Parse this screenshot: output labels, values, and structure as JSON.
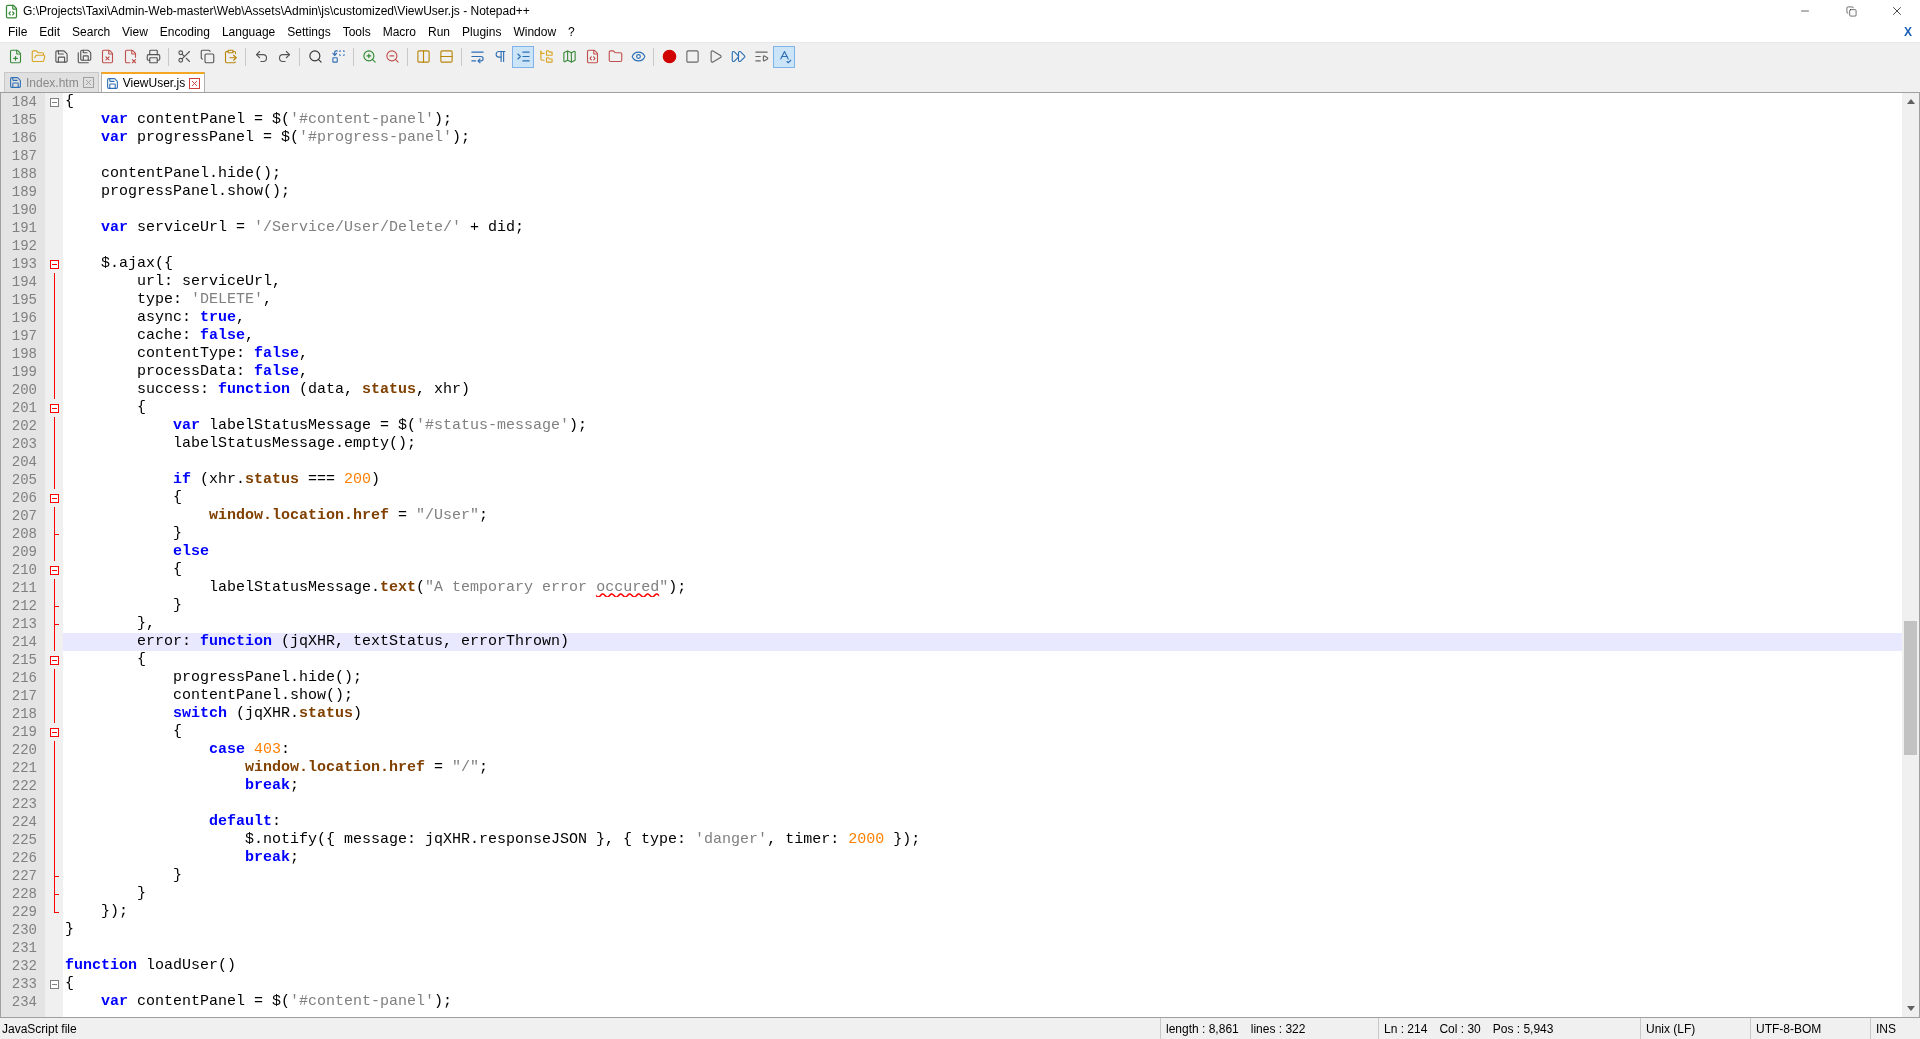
{
  "window": {
    "title": "G:\\Projects\\Taxi\\Admin-Web-master\\Web\\Assets\\Admin\\js\\customized\\ViewUser.js - Notepad++"
  },
  "menu": [
    "File",
    "Edit",
    "Search",
    "View",
    "Encoding",
    "Language",
    "Settings",
    "Tools",
    "Macro",
    "Run",
    "Plugins",
    "Window",
    "?"
  ],
  "menu_close": "X",
  "toolbar_buttons": [
    {
      "on": false
    },
    {
      "on": false
    },
    {
      "on": false
    },
    {
      "on": false
    },
    {
      "on": false
    },
    {
      "on": false
    },
    {
      "on": false
    },
    {
      "on": false
    },
    {
      "on": false
    },
    {
      "on": false
    },
    {
      "on": false
    },
    {
      "on": false
    },
    {
      "on": false
    },
    {
      "on": false
    },
    {
      "on": false
    },
    {
      "on": false
    },
    {
      "on": false
    },
    {
      "on": false
    },
    {
      "on": false
    },
    {
      "on": false
    },
    {
      "on": true
    },
    {
      "on": false
    },
    {
      "on": false
    },
    {
      "on": false
    },
    {
      "on": false
    },
    {
      "on": false
    },
    {
      "on": false
    },
    {
      "on": false
    },
    {
      "on": false
    },
    {
      "on": false
    },
    {
      "on": false
    },
    {
      "on": true
    }
  ],
  "tabs": [
    {
      "label": "Index.htm",
      "selected": false
    },
    {
      "label": "ViewUser.js",
      "selected": true
    }
  ],
  "editor": {
    "lines": [
      {
        "number": "184",
        "kind": "box",
        "current": false,
        "tokens": [
          {
            "kind": "txt",
            "text": "{"
          }
        ]
      },
      {
        "number": "185",
        "kind": "plain",
        "current": false,
        "tokens": [
          {
            "kind": "kw",
            "text": "    var"
          },
          {
            "kind": "txt",
            "text": " contentPanel = $("
          },
          {
            "kind": "str",
            "text": "'#content-panel'"
          },
          {
            "kind": "txt",
            "text": ");"
          }
        ]
      },
      {
        "number": "186",
        "kind": "plain",
        "current": false,
        "tokens": [
          {
            "kind": "kw",
            "text": "    var"
          },
          {
            "kind": "txt",
            "text": " progressPanel = $("
          },
          {
            "kind": "str",
            "text": "'#progress-panel'"
          },
          {
            "kind": "txt",
            "text": ");"
          }
        ]
      },
      {
        "number": "187",
        "kind": "plain"
      },
      {
        "number": "188",
        "kind": "plain",
        "current": false,
        "tokens": [
          {
            "kind": "txt",
            "text": "    contentPanel.hide();"
          }
        ]
      },
      {
        "number": "189",
        "kind": "plain",
        "current": false,
        "tokens": [
          {
            "kind": "txt",
            "text": "    progressPanel.show();"
          }
        ]
      },
      {
        "number": "190",
        "kind": "plain"
      },
      {
        "number": "191",
        "kind": "plain",
        "current": false,
        "tokens": [
          {
            "kind": "kw",
            "text": "    var"
          },
          {
            "kind": "txt",
            "text": " serviceUrl = "
          },
          {
            "kind": "str",
            "text": "'/Service/User/Delete/'"
          },
          {
            "kind": "txt",
            "text": " + did;"
          }
        ]
      },
      {
        "number": "192",
        "kind": "plain"
      },
      {
        "number": "193",
        "kind": "redbox",
        "current": false,
        "tokens": [
          {
            "kind": "txt",
            "text": "    $.ajax({"
          }
        ]
      },
      {
        "number": "194",
        "kind": "redline",
        "current": false,
        "tokens": [
          {
            "kind": "txt",
            "text": "        url: serviceUrl,"
          }
        ]
      },
      {
        "number": "195",
        "kind": "redline",
        "current": false,
        "tokens": [
          {
            "kind": "txt",
            "text": "        type: "
          },
          {
            "kind": "str",
            "text": "'DELETE'"
          },
          {
            "kind": "txt",
            "text": ","
          }
        ]
      },
      {
        "number": "196",
        "kind": "redline",
        "current": false,
        "tokens": [
          {
            "kind": "txt",
            "text": "        async: "
          },
          {
            "kind": "kw",
            "text": "true"
          },
          {
            "kind": "txt",
            "text": ","
          }
        ]
      },
      {
        "number": "197",
        "kind": "redline",
        "current": false,
        "tokens": [
          {
            "kind": "txt",
            "text": "        cache: "
          },
          {
            "kind": "kw",
            "text": "false"
          },
          {
            "kind": "txt",
            "text": ","
          }
        ]
      },
      {
        "number": "198",
        "kind": "redline",
        "current": false,
        "tokens": [
          {
            "kind": "txt",
            "text": "        contentType: "
          },
          {
            "kind": "kw",
            "text": "false"
          },
          {
            "kind": "txt",
            "text": ","
          }
        ]
      },
      {
        "number": "199",
        "kind": "redline",
        "current": false,
        "tokens": [
          {
            "kind": "txt",
            "text": "        processData: "
          },
          {
            "kind": "kw",
            "text": "false"
          },
          {
            "kind": "txt",
            "text": ","
          }
        ]
      },
      {
        "number": "200",
        "kind": "redline",
        "current": false,
        "tokens": [
          {
            "kind": "txt",
            "text": "        success: "
          },
          {
            "kind": "kw",
            "text": "function"
          },
          {
            "kind": "txt",
            "text": " (data, "
          },
          {
            "kind": "mem",
            "text": "status"
          },
          {
            "kind": "txt",
            "text": ", xhr)"
          }
        ]
      },
      {
        "number": "201",
        "kind": "redbox",
        "current": false,
        "tokens": [
          {
            "kind": "txt",
            "text": "        {"
          }
        ]
      },
      {
        "number": "202",
        "kind": "redline",
        "current": false,
        "tokens": [
          {
            "kind": "kw",
            "text": "            var"
          },
          {
            "kind": "txt",
            "text": " labelStatusMessage = $("
          },
          {
            "kind": "str",
            "text": "'#status-message'"
          },
          {
            "kind": "txt",
            "text": ");"
          }
        ]
      },
      {
        "number": "203",
        "kind": "redline",
        "current": false,
        "tokens": [
          {
            "kind": "txt",
            "text": "            labelStatusMessage.empty();"
          }
        ]
      },
      {
        "number": "204",
        "kind": "redline"
      },
      {
        "number": "205",
        "kind": "redline",
        "current": false,
        "tokens": [
          {
            "kind": "kw",
            "text": "            if"
          },
          {
            "kind": "txt",
            "text": " (xhr."
          },
          {
            "kind": "mem",
            "text": "status"
          },
          {
            "kind": "txt",
            "text": " === "
          },
          {
            "kind": "num",
            "text": "200"
          },
          {
            "kind": "txt",
            "text": ")"
          }
        ]
      },
      {
        "number": "206",
        "kind": "redbox",
        "current": false,
        "tokens": [
          {
            "kind": "txt",
            "text": "            {"
          }
        ]
      },
      {
        "number": "207",
        "kind": "redline",
        "current": false,
        "tokens": [
          {
            "kind": "mem",
            "text": "                window.location.href"
          },
          {
            "kind": "txt",
            "text": " = "
          },
          {
            "kind": "str",
            "text": "\"/User\""
          },
          {
            "kind": "txt",
            "text": ";"
          }
        ]
      },
      {
        "number": "208",
        "kind": "redtick",
        "current": false,
        "tokens": [
          {
            "kind": "txt",
            "text": "            }"
          }
        ]
      },
      {
        "number": "209",
        "kind": "redline",
        "current": false,
        "tokens": [
          {
            "kind": "kw",
            "text": "            else"
          }
        ]
      },
      {
        "number": "210",
        "kind": "redbox",
        "current": false,
        "tokens": [
          {
            "kind": "txt",
            "text": "            {"
          }
        ]
      },
      {
        "number": "211",
        "kind": "redline",
        "current": false,
        "tokens": [
          {
            "kind": "txt",
            "text": "                labelStatusMessage."
          },
          {
            "kind": "mem",
            "text": "text"
          },
          {
            "kind": "txt",
            "text": "("
          },
          {
            "kind": "str",
            "text": "\"A temporary error "
          },
          {
            "kind": "typo",
            "text": "occured"
          },
          {
            "kind": "str",
            "text": "\""
          },
          {
            "kind": "txt",
            "text": ");"
          }
        ]
      },
      {
        "number": "212",
        "kind": "redtick",
        "current": false,
        "tokens": [
          {
            "kind": "txt",
            "text": "            }"
          }
        ]
      },
      {
        "number": "213",
        "kind": "redtick",
        "current": false,
        "tokens": [
          {
            "kind": "txt",
            "text": "        },"
          }
        ]
      },
      {
        "number": "214",
        "kind": "redline",
        "current": true,
        "tokens": [
          {
            "kind": "txt",
            "text": "        error: "
          },
          {
            "kind": "kw",
            "text": "function"
          },
          {
            "kind": "txt",
            "text": " (jqXHR, textStatus, errorThrown)"
          }
        ]
      },
      {
        "number": "215",
        "kind": "redbox",
        "current": false,
        "tokens": [
          {
            "kind": "txt",
            "text": "        {"
          }
        ]
      },
      {
        "number": "216",
        "kind": "redline",
        "current": false,
        "tokens": [
          {
            "kind": "txt",
            "text": "            progressPanel.hide();"
          }
        ]
      },
      {
        "number": "217",
        "kind": "redline",
        "current": false,
        "tokens": [
          {
            "kind": "txt",
            "text": "            contentPanel.show();"
          }
        ]
      },
      {
        "number": "218",
        "kind": "redline",
        "current": false,
        "tokens": [
          {
            "kind": "kw",
            "text": "            switch"
          },
          {
            "kind": "txt",
            "text": " (jqXHR."
          },
          {
            "kind": "mem",
            "text": "status"
          },
          {
            "kind": "txt",
            "text": ")"
          }
        ]
      },
      {
        "number": "219",
        "kind": "redbox",
        "current": false,
        "tokens": [
          {
            "kind": "txt",
            "text": "            {"
          }
        ]
      },
      {
        "number": "220",
        "kind": "redline",
        "current": false,
        "tokens": [
          {
            "kind": "kw",
            "text": "                case"
          },
          {
            "kind": "num",
            "text": " 403"
          },
          {
            "kind": "txt",
            "text": ":"
          }
        ]
      },
      {
        "number": "221",
        "kind": "redline",
        "current": false,
        "tokens": [
          {
            "kind": "mem",
            "text": "                    window.location.href"
          },
          {
            "kind": "txt",
            "text": " = "
          },
          {
            "kind": "str",
            "text": "\"/\""
          },
          {
            "kind": "txt",
            "text": ";"
          }
        ]
      },
      {
        "number": "222",
        "kind": "redline",
        "current": false,
        "tokens": [
          {
            "kind": "kw",
            "text": "                    break"
          },
          {
            "kind": "txt",
            "text": ";"
          }
        ]
      },
      {
        "number": "223",
        "kind": "redline"
      },
      {
        "number": "224",
        "kind": "redline",
        "current": false,
        "tokens": [
          {
            "kind": "kw",
            "text": "                default"
          },
          {
            "kind": "txt",
            "text": ":"
          }
        ]
      },
      {
        "number": "225",
        "kind": "redline",
        "current": false,
        "tokens": [
          {
            "kind": "txt",
            "text": "                    $.notify({ message: jqXHR.responseJSON }, { type: "
          },
          {
            "kind": "str",
            "text": "'danger'"
          },
          {
            "kind": "txt",
            "text": ", timer: "
          },
          {
            "kind": "num",
            "text": "2000"
          },
          {
            "kind": "txt",
            "text": " });"
          }
        ]
      },
      {
        "number": "226",
        "kind": "redline",
        "current": false,
        "tokens": [
          {
            "kind": "kw",
            "text": "                    break"
          },
          {
            "kind": "txt",
            "text": ";"
          }
        ]
      },
      {
        "number": "227",
        "kind": "redtick",
        "current": false,
        "tokens": [
          {
            "kind": "txt",
            "text": "            }"
          }
        ]
      },
      {
        "number": "228",
        "kind": "redtick",
        "current": false,
        "tokens": [
          {
            "kind": "txt",
            "text": "        }"
          }
        ]
      },
      {
        "number": "229",
        "kind": "redend",
        "current": false,
        "tokens": [
          {
            "kind": "txt",
            "text": "    });"
          }
        ]
      },
      {
        "number": "230",
        "kind": "plain",
        "current": false,
        "tokens": [
          {
            "kind": "txt",
            "text": "}"
          }
        ]
      },
      {
        "number": "231",
        "kind": "plain"
      },
      {
        "number": "232",
        "kind": "plain",
        "current": false,
        "tokens": [
          {
            "kind": "kw",
            "text": "function"
          },
          {
            "kind": "txt",
            "text": " loadUser()"
          }
        ]
      },
      {
        "number": "233",
        "kind": "box",
        "current": false,
        "tokens": [
          {
            "kind": "txt",
            "text": "{"
          }
        ]
      },
      {
        "number": "234",
        "kind": "plain",
        "current": false,
        "tokens": [
          {
            "kind": "kw",
            "text": "    var"
          },
          {
            "kind": "txt",
            "text": " contentPanel = $("
          },
          {
            "kind": "str",
            "text": "'#content-panel'"
          },
          {
            "kind": "txt",
            "text": ");"
          }
        ]
      }
    ]
  },
  "status_bar": {
    "file_type": "JavaScript file",
    "length": "length : 8,861",
    "lines": "lines : 322",
    "ln": "Ln : 214",
    "col": "Col : 30",
    "pos": "Pos : 5,943",
    "eol": "Unix (LF)",
    "encoding": "UTF-8-BOM",
    "mode": "INS"
  }
}
